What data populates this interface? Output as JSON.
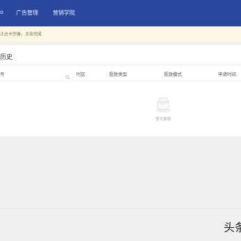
{
  "nav": {
    "items": [
      {
        "label": "o"
      },
      {
        "label": "广告管理"
      },
      {
        "label": "营销学院"
      }
    ]
  },
  "notice": {
    "text": "止达卡完善，点击完成"
  },
  "section": {
    "title": "历史"
  },
  "table": {
    "columns": [
      "号",
      "时区",
      "投放类型",
      "投放模式",
      "申请时间"
    ]
  },
  "empty": {
    "text": "暂无数据"
  },
  "watermark": {
    "text": "头条"
  },
  "colors": {
    "nav_bg": "#2a47a0",
    "notice_bg": "#fdf7e6",
    "panel_bg": "#ffffff",
    "page_bg": "#f0f0f0"
  }
}
